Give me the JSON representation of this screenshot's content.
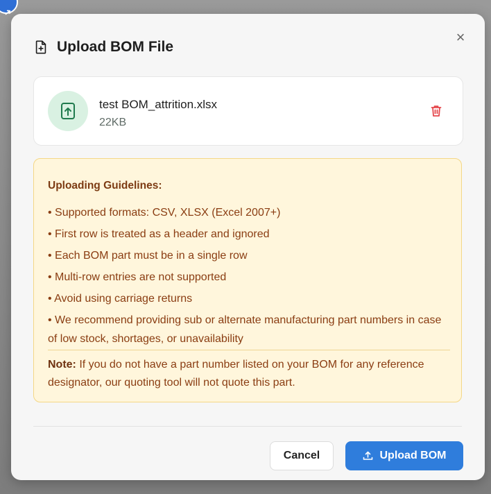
{
  "modal": {
    "title": "Upload BOM File",
    "close_glyph": "×"
  },
  "file": {
    "name": "test BOM_attrition.xlsx",
    "size": "22KB",
    "icon": "file-upload-icon",
    "delete_icon": "trash-icon"
  },
  "guidelines": {
    "title": "Uploading Guidelines:",
    "items": [
      "• Supported formats: CSV, XLSX (Excel 2007+)",
      "• First row is treated as a header and ignored",
      "• Each BOM part must be in a single row",
      "• Multi-row entries are not supported",
      "• Avoid using carriage returns",
      "• We recommend providing sub or alternate manufacturing part numbers in case of low stock, shortages, or unavailability"
    ],
    "note_label": "Note:",
    "note_text": " If you do not have a part number listed on your BOM for any reference designator, our quoting tool will not quote this part."
  },
  "actions": {
    "cancel_label": "Cancel",
    "upload_label": "Upload BOM"
  },
  "colors": {
    "primary": "#2f7ddc",
    "danger": "#e5484d",
    "success_bg": "#d9f1e2",
    "success_icon": "#1f7a4d",
    "warning_bg": "#fff6dc",
    "warning_text": "#8a3d12"
  }
}
